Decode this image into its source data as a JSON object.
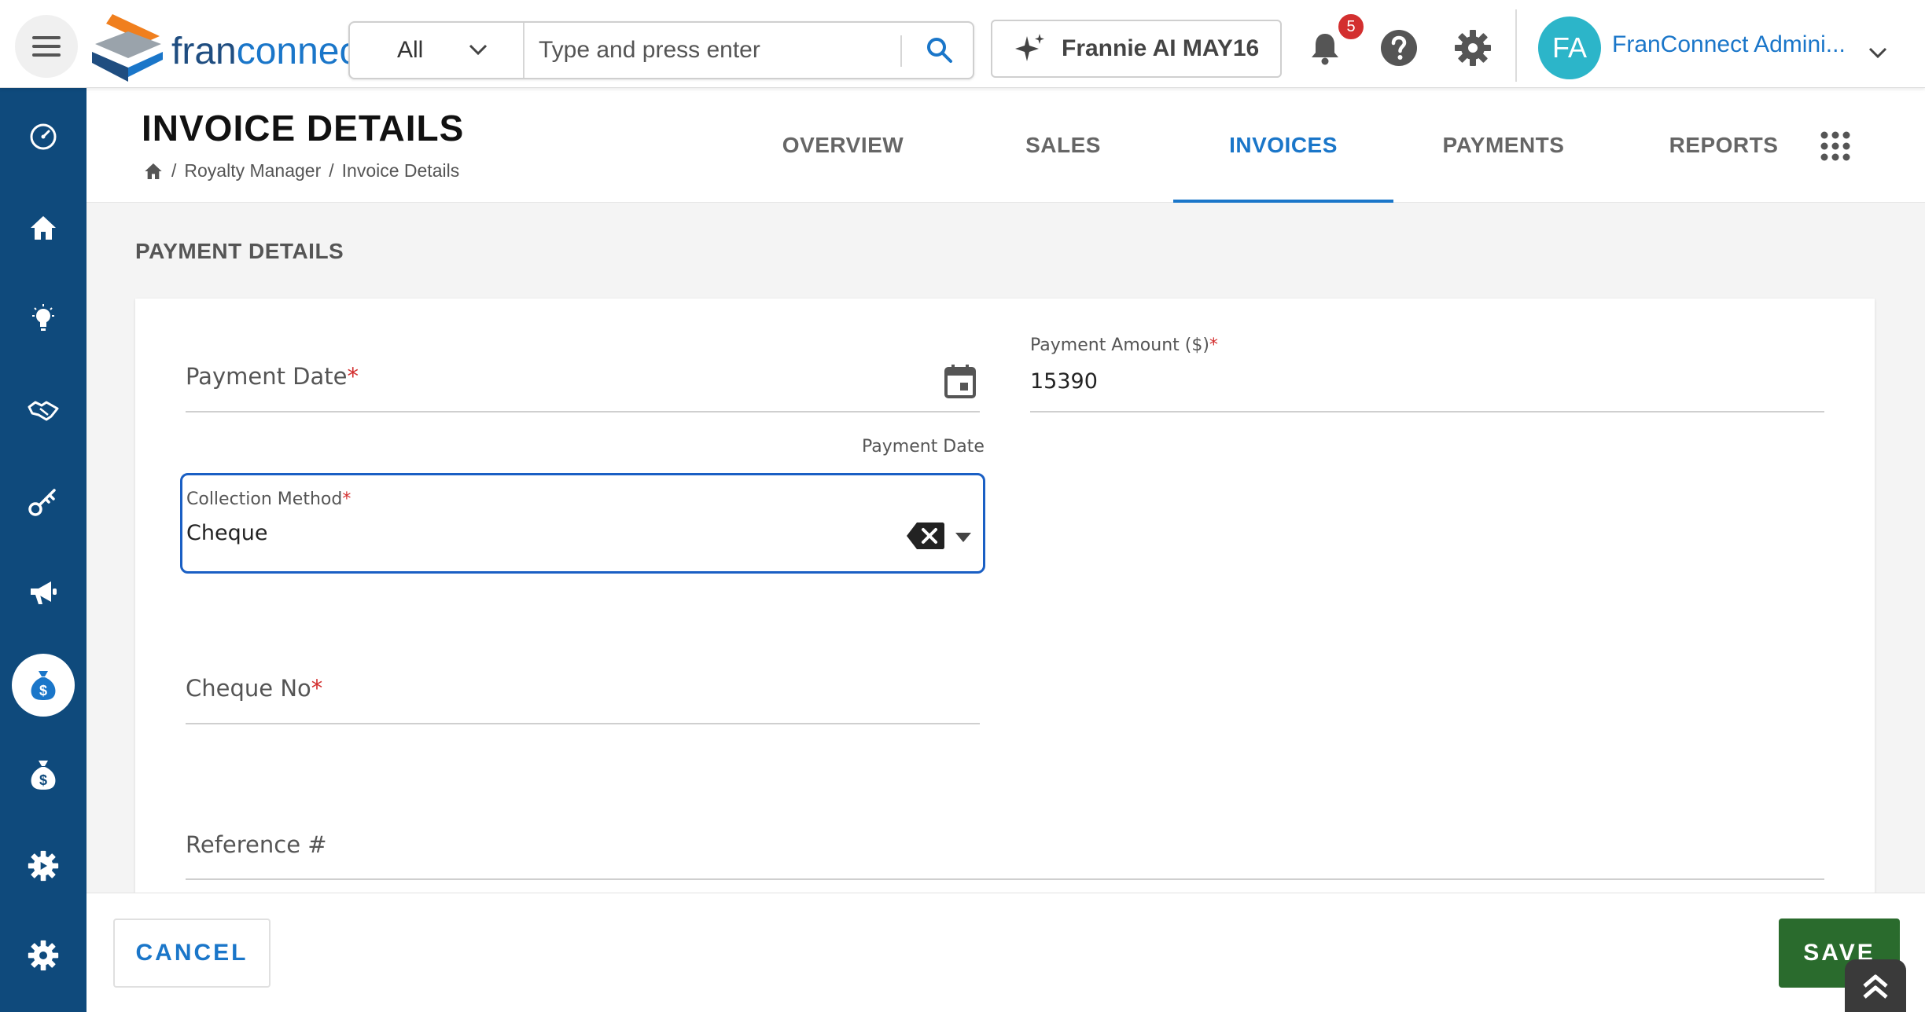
{
  "topbar": {
    "logo_text_part1": "fran",
    "logo_text_part2": "connect",
    "search_scope": "All",
    "search_placeholder": "Type and press enter",
    "ai_button_label": "Frannie AI MAY16",
    "notification_count": "5",
    "avatar_initials": "FA",
    "user_name": "FranConnect Admini..."
  },
  "header": {
    "title": "INVOICE DETAILS",
    "breadcrumb": [
      "Royalty Manager",
      "Invoice Details"
    ],
    "tabs": [
      {
        "label": "OVERVIEW",
        "active": false
      },
      {
        "label": "SALES",
        "active": false
      },
      {
        "label": "INVOICES",
        "active": true
      },
      {
        "label": "PAYMENTS",
        "active": false
      },
      {
        "label": "REPORTS",
        "active": false
      }
    ]
  },
  "section": {
    "title": "PAYMENT DETAILS"
  },
  "form": {
    "payment_date": {
      "label": "Payment Date",
      "value": "",
      "helper": "Payment Date"
    },
    "payment_amount": {
      "label": "Payment Amount ($)",
      "value": "15390"
    },
    "collection_method": {
      "label": "Collection Method",
      "value": "Cheque"
    },
    "cheque_no": {
      "label": "Cheque No",
      "value": ""
    },
    "reference": {
      "label": "Reference #",
      "value": ""
    }
  },
  "footer": {
    "cancel_label": "CANCEL",
    "save_label": "SAVE"
  },
  "colors": {
    "primary": "#1a76c9",
    "sidebar": "#0f4a7c",
    "save": "#2a6b2d",
    "focus_border": "#1a5fc4",
    "required": "#d32f2f"
  },
  "icons": {
    "sidebar": [
      "dashboard-icon",
      "home-icon",
      "lightbulb-icon",
      "handshake-icon",
      "key-icon",
      "megaphone-icon",
      "money-bag-dollar-icon",
      "money-bag-icon",
      "settings-gear-icon",
      "cog-icon"
    ]
  }
}
